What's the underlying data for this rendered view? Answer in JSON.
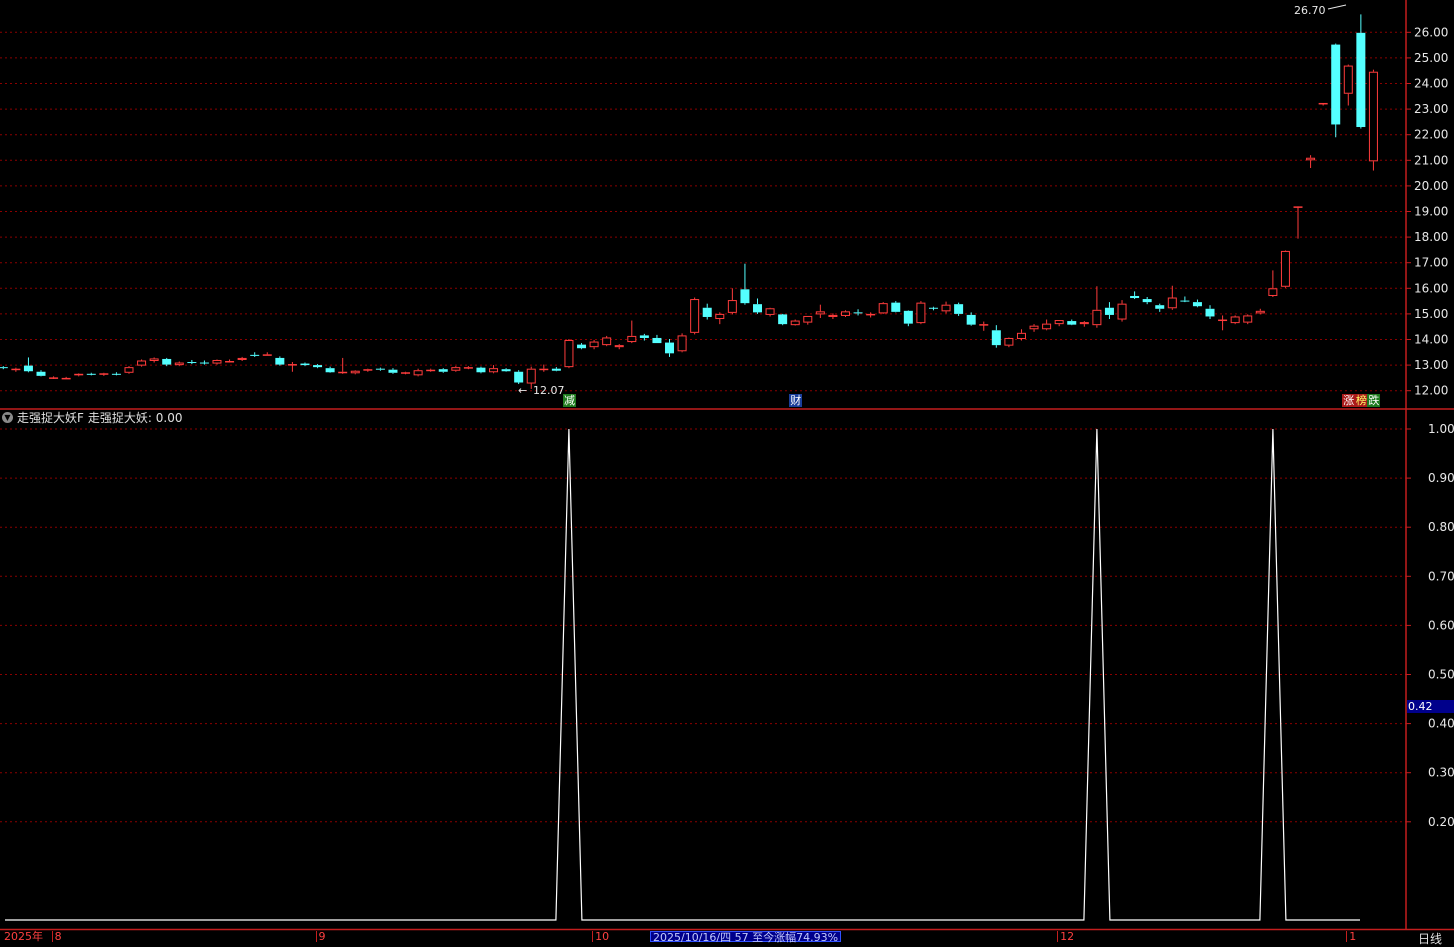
{
  "colors": {
    "up": "#ff3c3c",
    "down": "#54ffff",
    "grid": "#8b0000",
    "frame": "#c41e1e",
    "axis_text": "#e8e8e8",
    "indicator_line": "#ffffff"
  },
  "chart_data": [
    {
      "type": "candlestick",
      "ylim": [
        11.6,
        26.8
      ],
      "yticks": [
        "12.00",
        "13.00",
        "14.00",
        "15.00",
        "16.00",
        "17.00",
        "18.00",
        "19.00",
        "20.00",
        "21.00",
        "22.00",
        "23.00",
        "24.00",
        "25.00",
        "26.00"
      ],
      "grid": true,
      "high_marker": "26.70",
      "low_marker": "12.07",
      "candles": [
        [
          12.92,
          12.96,
          12.84,
          12.9
        ],
        [
          12.82,
          12.9,
          12.74,
          12.86
        ],
        [
          12.98,
          13.3,
          12.72,
          12.76
        ],
        [
          12.74,
          12.8,
          12.56,
          12.58
        ],
        [
          12.5,
          12.56,
          12.46,
          12.52
        ],
        [
          12.5,
          12.54,
          12.46,
          12.5
        ],
        [
          12.6,
          12.68,
          12.56,
          12.66
        ],
        [
          12.66,
          12.7,
          12.6,
          12.64
        ],
        [
          12.64,
          12.7,
          12.58,
          12.68
        ],
        [
          12.66,
          12.72,
          12.6,
          12.64
        ],
        [
          12.7,
          12.96,
          12.66,
          12.92
        ],
        [
          12.98,
          13.22,
          12.94,
          13.18
        ],
        [
          13.16,
          13.3,
          13.1,
          13.26
        ],
        [
          13.24,
          13.28,
          12.96,
          13.02
        ],
        [
          13.0,
          13.14,
          12.96,
          13.1
        ],
        [
          13.12,
          13.2,
          13.04,
          13.1
        ],
        [
          13.1,
          13.18,
          13.02,
          13.08
        ],
        [
          13.06,
          13.22,
          13.02,
          13.2
        ],
        [
          13.14,
          13.22,
          13.1,
          13.16
        ],
        [
          13.2,
          13.32,
          13.16,
          13.28
        ],
        [
          13.4,
          13.5,
          13.32,
          13.36
        ],
        [
          13.42,
          13.5,
          13.38,
          13.42
        ],
        [
          13.28,
          13.34,
          12.98,
          13.02
        ],
        [
          13.0,
          13.12,
          12.74,
          13.04
        ],
        [
          13.06,
          13.1,
          12.96,
          13.0
        ],
        [
          13.0,
          13.04,
          12.88,
          12.92
        ],
        [
          12.88,
          12.94,
          12.7,
          12.72
        ],
        [
          12.7,
          13.28,
          12.66,
          12.74
        ],
        [
          12.68,
          12.8,
          12.64,
          12.78
        ],
        [
          12.8,
          12.86,
          12.74,
          12.84
        ],
        [
          12.86,
          12.9,
          12.78,
          12.82
        ],
        [
          12.82,
          12.88,
          12.66,
          12.7
        ],
        [
          12.7,
          12.74,
          12.64,
          12.72
        ],
        [
          12.6,
          12.86,
          12.56,
          12.8
        ],
        [
          12.8,
          12.86,
          12.74,
          12.82
        ],
        [
          12.84,
          12.88,
          12.7,
          12.74
        ],
        [
          12.78,
          12.96,
          12.74,
          12.92
        ],
        [
          12.9,
          12.96,
          12.84,
          12.92
        ],
        [
          12.9,
          12.94,
          12.68,
          12.72
        ],
        [
          12.72,
          13.0,
          12.68,
          12.88
        ],
        [
          12.84,
          12.88,
          12.74,
          12.76
        ],
        [
          12.74,
          12.8,
          12.26,
          12.32
        ],
        [
          12.28,
          12.94,
          12.07,
          12.86
        ],
        [
          12.82,
          13.02,
          12.74,
          12.86
        ],
        [
          12.86,
          12.92,
          12.76,
          12.78
        ],
        [
          12.92,
          14.02,
          12.88,
          13.98
        ],
        [
          13.8,
          13.86,
          13.62,
          13.66
        ],
        [
          13.7,
          13.98,
          13.62,
          13.92
        ],
        [
          13.78,
          14.14,
          13.74,
          14.08
        ],
        [
          13.7,
          13.82,
          13.62,
          13.78
        ],
        [
          13.9,
          14.74,
          13.86,
          14.14
        ],
        [
          14.16,
          14.22,
          13.96,
          14.06
        ],
        [
          14.06,
          14.18,
          13.86,
          13.86
        ],
        [
          13.88,
          14.02,
          13.32,
          13.46
        ],
        [
          13.54,
          14.24,
          13.5,
          14.16
        ],
        [
          14.26,
          15.64,
          14.2,
          15.58
        ],
        [
          15.24,
          15.4,
          14.78,
          14.88
        ],
        [
          14.8,
          15.06,
          14.6,
          15.0
        ],
        [
          15.04,
          16.0,
          14.98,
          15.54
        ],
        [
          15.96,
          16.96,
          15.36,
          15.42
        ],
        [
          15.38,
          15.6,
          15.0,
          15.06
        ],
        [
          14.96,
          15.24,
          14.9,
          15.22
        ],
        [
          14.98,
          15.0,
          14.56,
          14.6
        ],
        [
          14.56,
          14.78,
          14.54,
          14.74
        ],
        [
          14.66,
          14.92,
          14.58,
          14.92
        ],
        [
          14.98,
          15.36,
          14.84,
          15.1
        ],
        [
          14.88,
          15.02,
          14.8,
          14.96
        ],
        [
          14.92,
          15.14,
          14.88,
          15.1
        ],
        [
          15.06,
          15.18,
          14.94,
          15.02
        ],
        [
          14.98,
          15.06,
          14.86,
          15.0
        ],
        [
          15.02,
          15.46,
          15.0,
          15.42
        ],
        [
          15.44,
          15.5,
          15.06,
          15.08
        ],
        [
          15.12,
          15.14,
          14.52,
          14.62
        ],
        [
          14.64,
          15.5,
          14.6,
          15.44
        ],
        [
          15.24,
          15.28,
          15.14,
          15.22
        ],
        [
          15.1,
          15.48,
          15.02,
          15.36
        ],
        [
          15.38,
          15.44,
          14.92,
          15.0
        ],
        [
          14.96,
          15.06,
          14.54,
          14.58
        ],
        [
          14.56,
          14.7,
          14.34,
          14.6
        ],
        [
          14.36,
          14.56,
          13.68,
          13.78
        ],
        [
          13.76,
          14.08,
          13.7,
          14.06
        ],
        [
          14.02,
          14.4,
          13.96,
          14.26
        ],
        [
          14.4,
          14.6,
          14.3,
          14.54
        ],
        [
          14.4,
          14.78,
          14.36,
          14.62
        ],
        [
          14.6,
          14.76,
          14.52,
          14.76
        ],
        [
          14.72,
          14.78,
          14.56,
          14.58
        ],
        [
          14.6,
          14.72,
          14.5,
          14.68
        ],
        [
          14.56,
          16.08,
          14.46,
          15.16
        ],
        [
          15.24,
          15.46,
          14.8,
          14.96
        ],
        [
          14.78,
          15.54,
          14.7,
          15.4
        ],
        [
          15.7,
          15.88,
          15.58,
          15.62
        ],
        [
          15.58,
          15.66,
          15.38,
          15.46
        ],
        [
          15.34,
          15.4,
          15.08,
          15.2
        ],
        [
          15.22,
          16.1,
          15.16,
          15.64
        ],
        [
          15.52,
          15.68,
          15.46,
          15.5
        ],
        [
          15.46,
          15.56,
          15.26,
          15.3
        ],
        [
          15.2,
          15.34,
          14.8,
          14.9
        ],
        [
          14.78,
          14.94,
          14.36,
          14.78
        ],
        [
          14.64,
          14.94,
          14.6,
          14.9
        ],
        [
          14.66,
          14.98,
          14.6,
          14.94
        ],
        [
          15.02,
          15.2,
          14.98,
          15.12
        ],
        [
          15.7,
          16.7,
          15.66,
          16.0
        ],
        [
          16.06,
          17.48,
          16.02,
          17.46
        ],
        [
          19.2,
          19.2,
          17.94,
          19.2
        ],
        [
          21.0,
          21.2,
          20.7,
          21.1
        ],
        [
          23.2,
          23.24,
          23.14,
          23.24
        ],
        [
          25.52,
          25.56,
          21.9,
          22.4
        ],
        [
          23.6,
          24.74,
          23.14,
          24.7
        ],
        [
          25.98,
          26.7,
          22.24,
          22.3
        ],
        [
          20.96,
          24.54,
          20.6,
          24.46
        ]
      ]
    },
    {
      "type": "line",
      "name": "走强捉大妖",
      "ylim": [
        0.0,
        1.05
      ],
      "yticks": [
        "0.20",
        "0.30",
        "0.40",
        "0.50",
        "0.60",
        "0.70",
        "0.80",
        "0.90",
        "1.00"
      ],
      "grid": true,
      "values": [
        0,
        0,
        0,
        0,
        0,
        0,
        0,
        0,
        0,
        0,
        0,
        0,
        0,
        0,
        0,
        0,
        0,
        0,
        0,
        0,
        0,
        0,
        0,
        0,
        0,
        0,
        0,
        0,
        0,
        0,
        0,
        0,
        0,
        0,
        0,
        0,
        0,
        0,
        0,
        0,
        0,
        0,
        0,
        0,
        0,
        1,
        0,
        0,
        0,
        0,
        0,
        0,
        0,
        0,
        0,
        0,
        0,
        0,
        0,
        0,
        0,
        0,
        0,
        0,
        0,
        0,
        0,
        0,
        0,
        0,
        0,
        0,
        0,
        0,
        0,
        0,
        0,
        0,
        0,
        0,
        0,
        0,
        0,
        0,
        0,
        0,
        0,
        1,
        0,
        0,
        0,
        0,
        0,
        0,
        0,
        0,
        0,
        0,
        0,
        0,
        0,
        1,
        0,
        0,
        0,
        0,
        0,
        0,
        0,
        0
      ]
    }
  ],
  "indicator": {
    "name": "走强捉大妖F",
    "value_text": "走强捉大妖: 0.00",
    "current_tag": "0.42"
  },
  "events": [
    {
      "label": "减",
      "bg": "#1e7a1e",
      "fg": "#ffffff",
      "bar": 45
    },
    {
      "label": "财",
      "bg": "#1a3e9a",
      "fg": "#ffffff",
      "bar": 63
    },
    {
      "label": "涨",
      "bg": "#aa1a1a",
      "fg": "#ffffff",
      "bar": 107
    },
    {
      "label": "榜",
      "bg": "#aa1a1a",
      "fg": "#ffff66",
      "bar": 108
    },
    {
      "label": "跌",
      "bg": "#1e7a1e",
      "fg": "#ffffff",
      "bar": 109
    }
  ],
  "xaxis": {
    "labels": [
      {
        "text": "2025年",
        "bar": -0.6
      },
      {
        "text": "8",
        "bar": 4
      },
      {
        "text": "9",
        "bar": 25
      },
      {
        "text": "10",
        "bar": 47
      },
      {
        "text": "12",
        "bar": 84
      },
      {
        "text": "1",
        "bar": 107
      }
    ],
    "status": "2025/10/16/四 57 至今涨幅74.93%",
    "period": "日线"
  }
}
